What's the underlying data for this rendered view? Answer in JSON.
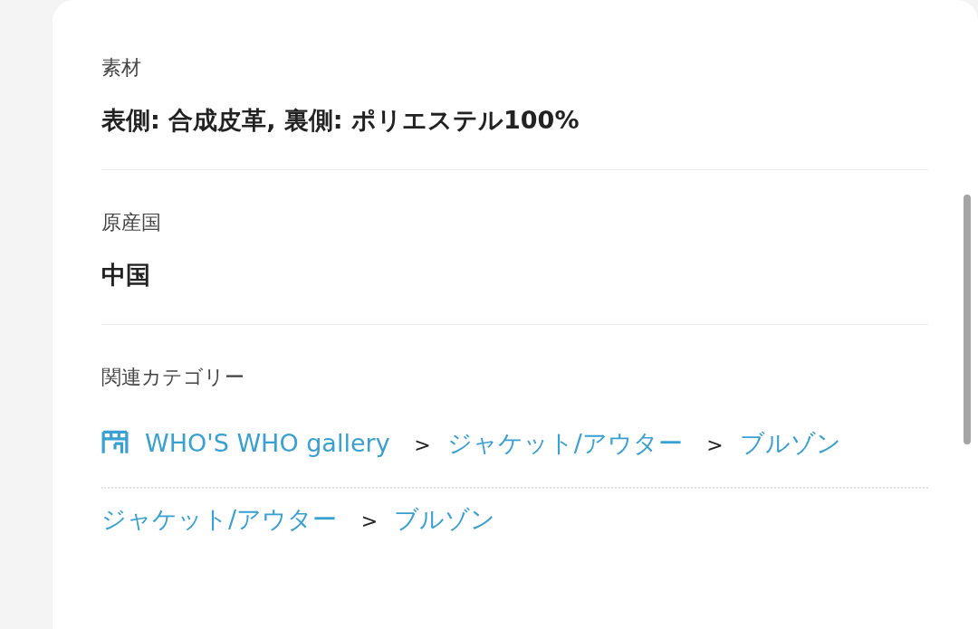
{
  "details": [
    {
      "label": "素材",
      "value": "表側: 合成皮革, 裏側: ポリエステル100%"
    },
    {
      "label": "原産国",
      "value": "中国"
    }
  ],
  "related_categories": {
    "label": "関連カテゴリー",
    "paths": [
      {
        "kind": "shop",
        "items": [
          "WHO'S WHO gallery",
          "ジャケット/アウター",
          "ブルゾン"
        ],
        "separator": ">"
      },
      {
        "kind": "plain",
        "items": [
          "ジャケット/アウター",
          "ブルゾン"
        ],
        "separator": ">"
      }
    ]
  }
}
